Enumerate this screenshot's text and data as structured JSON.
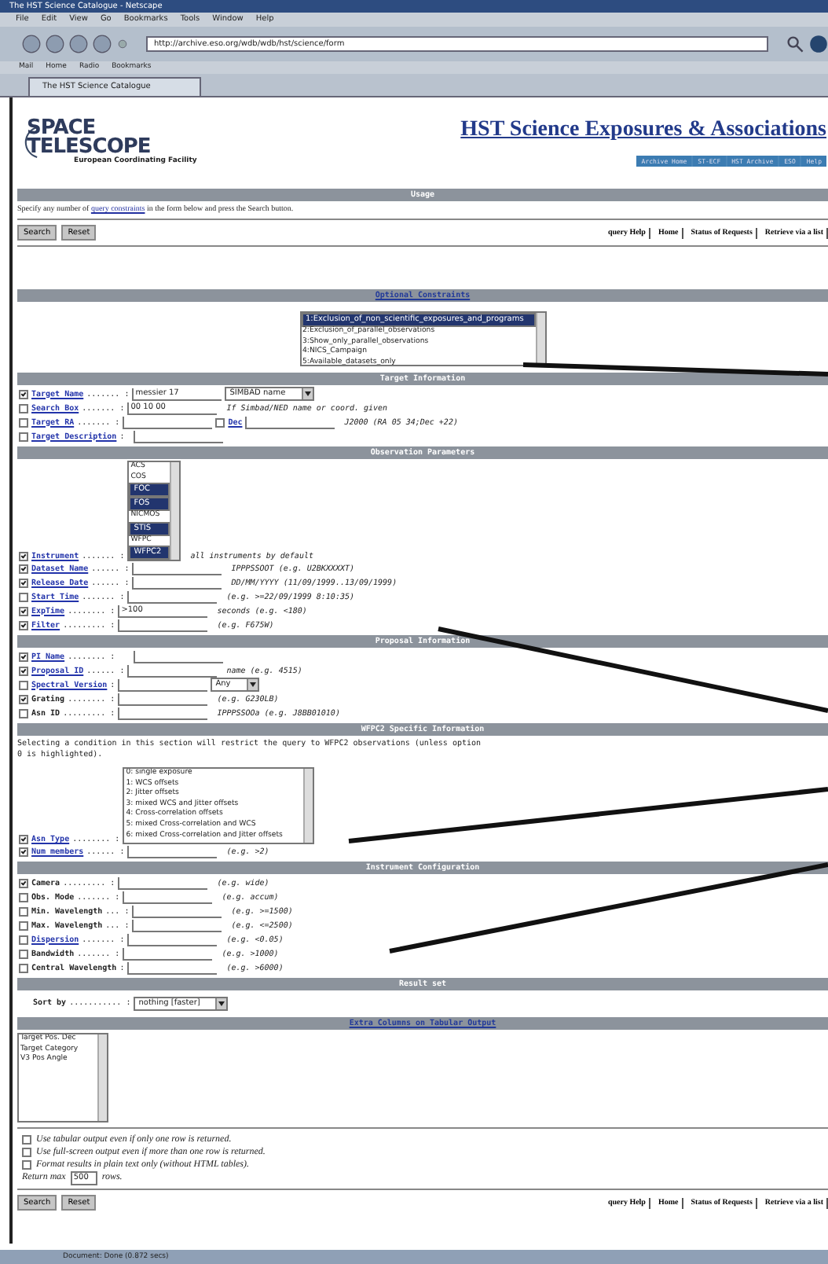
{
  "browser": {
    "title": "The HST Science Catalogue - Netscape",
    "menus": [
      "File",
      "Edit",
      "View",
      "Go",
      "Bookmarks",
      "Tools",
      "Window",
      "Help"
    ],
    "url": "http://archive.eso.org/wdb/wdb/hst/science/form",
    "toolbar": [
      "Mail",
      "Home",
      "Radio",
      "Bookmarks"
    ],
    "tab": "The HST Science Catalogue",
    "status": "Document: Done (0.872 secs)"
  },
  "header": {
    "logo_lines": [
      "SPACE",
      "TELESCOPE"
    ],
    "logo_caption": "European Coordinating Facility",
    "title": "HST Science Exposures & Associations",
    "nav": [
      "Archive Home",
      "ST-ECF",
      "HST Archive",
      "ESO",
      "Help"
    ]
  },
  "usage": {
    "heading": "Usage",
    "before": "Specify any number of ",
    "link": "query constraints",
    "after": " in the form below and press the Search button."
  },
  "top_buttons": {
    "left": [
      "Search",
      "Reset"
    ],
    "right": [
      "query Help",
      "Home",
      "Status of Requests",
      "Retrieve via a list"
    ]
  },
  "sections": [
    {
      "heading": "Optional Constraints",
      "link": true,
      "items": [
        {
          "kind": "listbox",
          "options": [
            {
              "label": "1:Exclusion_of_non_scientific_exposures_and_programs",
              "selected": true
            },
            {
              "label": "2:Exclusion_of_parallel_observations",
              "selected": false
            },
            {
              "label": "3:Show_only_parallel_observations",
              "selected": false
            },
            {
              "label": "4:NICS_Campaign",
              "selected": false
            },
            {
              "label": "5:Available_datasets_only",
              "selected": false
            }
          ]
        }
      ]
    },
    {
      "heading": "Target Information",
      "link": false,
      "items": [
        {
          "kind": "field",
          "checked": true,
          "label": "Target Name",
          "leader": "....... :",
          "link": true,
          "value": "messier 17",
          "select": "SIMBAD name"
        },
        {
          "kind": "field",
          "checked": false,
          "label": "Search Box",
          "leader": "....... :",
          "link": true,
          "value": "00 10 00",
          "hint": "If Simbad/NED name or coord. given"
        },
        {
          "kind": "field",
          "checked": false,
          "label": "Target RA",
          "leader": "....... :",
          "link": true,
          "extra": "Dec",
          "extra_checked": false,
          "hint": "J2000 (RA 05 34;Dec +22)"
        },
        {
          "kind": "field",
          "checked": false,
          "label": "Target Description",
          "leader": ":",
          "link": true
        }
      ]
    },
    {
      "heading": "Observation Parameters",
      "link": false,
      "items": [
        {
          "kind": "listfield",
          "checked": true,
          "label": "Instrument",
          "leader": "....... :",
          "link": true,
          "options": [
            {
              "label": "ACS",
              "selected": false
            },
            {
              "label": "COS",
              "selected": false
            },
            {
              "label": "FOC",
              "selected": true
            },
            {
              "label": "FOS",
              "selected": true
            },
            {
              "label": "NICMOS",
              "selected": false
            },
            {
              "label": "STIS",
              "selected": true
            },
            {
              "label": "WFPC",
              "selected": false
            },
            {
              "label": "WFPC2",
              "selected": true
            }
          ],
          "hint": "all instruments by default"
        },
        {
          "kind": "field",
          "checked": true,
          "label": "Dataset Name",
          "leader": "...... :",
          "link": true,
          "hint": "IPPPSSOOT (e.g. U2BKXXXXT)"
        },
        {
          "kind": "field",
          "checked": true,
          "label": "Release Date",
          "leader": "...... :",
          "link": true,
          "hint": "DD/MM/YYYY (11/09/1999..13/09/1999)"
        },
        {
          "kind": "field",
          "checked": false,
          "label": "Start Time",
          "leader": "....... :",
          "link": true,
          "hint": "(e.g. >=22/09/1999 8:10:35)"
        },
        {
          "kind": "field",
          "checked": true,
          "label": "ExpTime",
          "leader": "........ :",
          "link": true,
          "value": ">100",
          "hint": "seconds (e.g. <180)"
        },
        {
          "kind": "field",
          "checked": true,
          "label": "Filter",
          "leader": "......... :",
          "link": true,
          "hint": "(e.g. F675W)"
        }
      ]
    },
    {
      "heading": "Proposal Information",
      "link": false,
      "items": [
        {
          "kind": "field",
          "checked": true,
          "label": "PI Name",
          "leader": "........ :",
          "link": true
        },
        {
          "kind": "field",
          "checked": true,
          "label": "Proposal ID",
          "leader": "...... :",
          "link": true,
          "hint": "name (e.g. 4515)"
        },
        {
          "kind": "field",
          "checked": false,
          "label": "Spectral Version",
          "leader": ":",
          "link": true,
          "select": "Any"
        },
        {
          "kind": "field",
          "checked": true,
          "label": "Grating",
          "leader": "........ :",
          "link": false,
          "hint": "(e.g. G230LB)"
        },
        {
          "kind": "field",
          "checked": false,
          "label": "Asn ID",
          "leader": "......... :",
          "link": false,
          "hint": "IPPPSSOOa (e.g. J8BB01010)"
        }
      ]
    },
    {
      "heading": "WFPC2 Specific Information",
      "link": false,
      "note": "Selecting a condition in this section will restrict the query to WFPC2 observations (unless option 0 is highlighted).",
      "items": [
        {
          "kind": "listfield",
          "checked": true,
          "label": "Asn Type",
          "leader": "........ :",
          "link": true,
          "wide": true,
          "options": [
            {
              "label": "0: single exposure",
              "selected": false
            },
            {
              "label": "1: WCS offsets",
              "selected": false
            },
            {
              "label": "2: Jitter offsets",
              "selected": false
            },
            {
              "label": "3: mixed WCS and Jitter offsets",
              "selected": false
            },
            {
              "label": "4: Cross-correlation offsets",
              "selected": false
            },
            {
              "label": "5: mixed Cross-correlation and WCS",
              "selected": false
            },
            {
              "label": "6: mixed Cross-correlation and Jitter offsets",
              "selected": false
            }
          ]
        },
        {
          "kind": "field",
          "checked": true,
          "label": "Num members",
          "leader": "...... :",
          "link": true,
          "hint": "(e.g. >2)"
        }
      ]
    },
    {
      "heading": "Instrument Configuration",
      "link": false,
      "items": [
        {
          "kind": "field",
          "checked": true,
          "label": "Camera",
          "leader": "......... :",
          "link": false,
          "hint": "(e.g. wide)"
        },
        {
          "kind": "field",
          "checked": false,
          "label": "Obs. Mode",
          "leader": "....... :",
          "link": false,
          "hint": "(e.g. accum)"
        },
        {
          "kind": "field",
          "checked": false,
          "label": "Min. Wavelength",
          "leader": "... :",
          "link": false,
          "hint": "(e.g. >=1500)"
        },
        {
          "kind": "field",
          "checked": false,
          "label": "Max. Wavelength",
          "leader": "... :",
          "link": false,
          "hint": "(e.g. <=2500)"
        },
        {
          "kind": "field",
          "checked": false,
          "label": "Dispersion",
          "leader": "....... :",
          "link": true,
          "hint": "(e.g. <0.05)"
        },
        {
          "kind": "field",
          "checked": false,
          "label": "Bandwidth",
          "leader": "....... :",
          "link": false,
          "hint": "(e.g. >1000)"
        },
        {
          "kind": "field",
          "checked": false,
          "label": "Central Wavelength",
          "leader": ":",
          "link": false,
          "hint": "(e.g. >6000)"
        }
      ]
    },
    {
      "heading": "Result set",
      "link": false,
      "items": [
        {
          "kind": "sort",
          "label": "Sort by",
          "leader": "........... :",
          "select": "nothing [faster]"
        }
      ]
    },
    {
      "heading": "Extra Columns on Tabular Output",
      "link": true,
      "items": [
        {
          "kind": "columns",
          "options": [
            {
              "label": "Target Pos. Dec",
              "selected": false
            },
            {
              "label": "Target Category",
              "selected": false
            },
            {
              "label": "V3 Pos Angle",
              "selected": false
            }
          ]
        }
      ]
    }
  ],
  "output_options": [
    {
      "label": "Use tabular output even if only one row is returned.",
      "checked": false
    },
    {
      "label": "Use full-screen output even if more than one row is returned.",
      "checked": false
    },
    {
      "label": "Format results in plain text only (without HTML tables).",
      "checked": false
    }
  ],
  "return_max": {
    "before": "Return max",
    "value": "500",
    "after": "rows."
  },
  "bottom_buttons": {
    "left": [
      "Search",
      "Reset"
    ],
    "right": [
      "query Help",
      "Home",
      "Status of Requests",
      "Retrieve via a list"
    ]
  }
}
